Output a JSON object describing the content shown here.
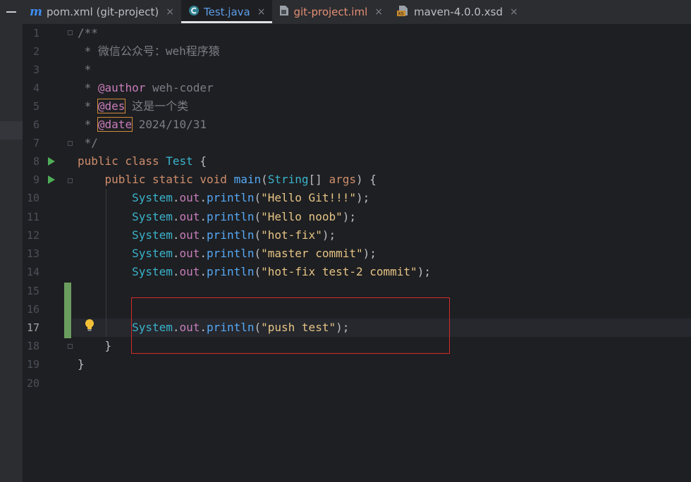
{
  "tabs": [
    {
      "label": "pom.xml (git-project)",
      "icon": "maven-m-icon",
      "close": "×"
    },
    {
      "label": "Test.java",
      "icon": "java-class-icon",
      "close": "×"
    },
    {
      "label": "git-project.iml",
      "icon": "module-file-icon",
      "close": "×"
    },
    {
      "label": "maven-4.0.0.xsd",
      "icon": "xsd-file-icon",
      "close": "×"
    }
  ],
  "active_tab": "Test.java",
  "editor": {
    "current_line": 17,
    "line_numbers": [
      "1",
      "2",
      "3",
      "4",
      "5",
      "6",
      "7",
      "8",
      "9",
      "10",
      "11",
      "12",
      "13",
      "14",
      "15",
      "16",
      "17",
      "18",
      "19",
      "20"
    ],
    "lines": {
      "l1": "/**",
      "l2": " * 微信公众号：weh程序猿",
      "l3": " *",
      "l4_prefix": " * ",
      "l4_tag": "@author",
      "l4_text": " weh-coder",
      "l5_prefix": " * ",
      "l5_tag": "@des",
      "l5_text": " 这是一个类",
      "l6_prefix": " * ",
      "l6_tag": "@date",
      "l6_text": " 2024/10/31",
      "l7": " */",
      "l8_kw": "public class ",
      "l8_name": "Test",
      "l8_rest": " {",
      "l9_indent": "    ",
      "l9_kw": "public static void ",
      "l9_method": "main",
      "l9_p1": "(",
      "l9_type": "String",
      "l9_p2": "[] ",
      "l9_arg": "args",
      "l9_p3": ") {",
      "print_indent": "        ",
      "sys": "System",
      "dot": ".",
      "out": "out",
      "println": "println",
      "open": "(",
      "close": ");",
      "s10": "\"Hello Git!!!\"",
      "s11": "\"Hello noob\"",
      "s12": "\"hot-fix\"",
      "s13": "\"master commit\"",
      "s14": "\"hot-fix test-2 commit\"",
      "s17": "\"push test\"",
      "l18": "    }",
      "l19": "}"
    }
  },
  "colors": {
    "keyword": "#cf8e6d",
    "string": "#e5c07b",
    "class": "#56a8f5",
    "comment": "#7a7e85",
    "highlight_box": "#d42a2a",
    "vcs_added": "#6b9e5e"
  }
}
